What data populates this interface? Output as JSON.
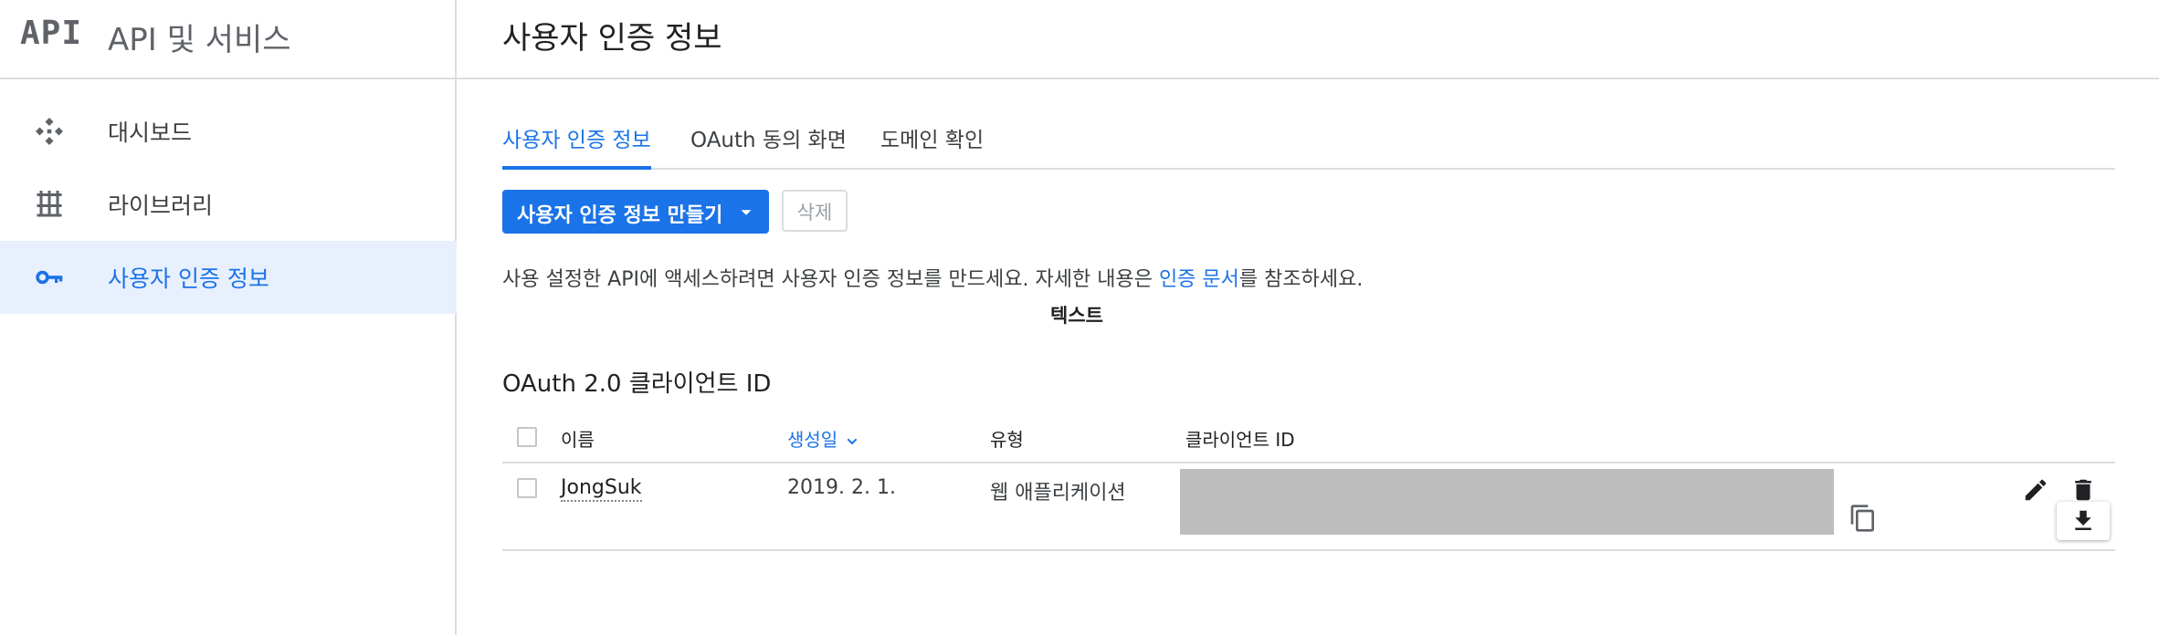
{
  "sidebar": {
    "logo": "API",
    "title": "API 및 서비스",
    "items": [
      {
        "label": "대시보드",
        "icon": "dashboard-icon"
      },
      {
        "label": "라이브러리",
        "icon": "library-icon"
      },
      {
        "label": "사용자 인증 정보",
        "icon": "key-icon",
        "active": true
      }
    ]
  },
  "header": {
    "title": "사용자 인증 정보"
  },
  "tabs": [
    {
      "label": "사용자 인증 정보",
      "active": true
    },
    {
      "label": "OAuth 동의 화면"
    },
    {
      "label": "도메인 확인"
    }
  ],
  "toolbar": {
    "create_label": "사용자 인증 정보 만들기",
    "delete_label": "삭제"
  },
  "description": {
    "before": "사용 설정한 API에 액세스하려면 사용자 인증 정보를 만드세요. 자세한 내용은 ",
    "link": "인증 문서",
    "after": "를 참조하세요."
  },
  "stray_text": "텍스트",
  "oauth_section": {
    "title": "OAuth 2.0 클라이언트 ID",
    "columns": {
      "name": "이름",
      "created": "생성일",
      "type": "유형",
      "client_id": "클라이언트 ID"
    },
    "rows": [
      {
        "name": "JongSuk",
        "created": "2019. 2. 1.",
        "type": "웹 애플리케이션",
        "client_id": ""
      }
    ]
  },
  "colors": {
    "accent": "#1a73e8",
    "active_nav_bg": "#e8f0fe",
    "divider": "#dadce0",
    "redaction": "#bdbdbd"
  }
}
